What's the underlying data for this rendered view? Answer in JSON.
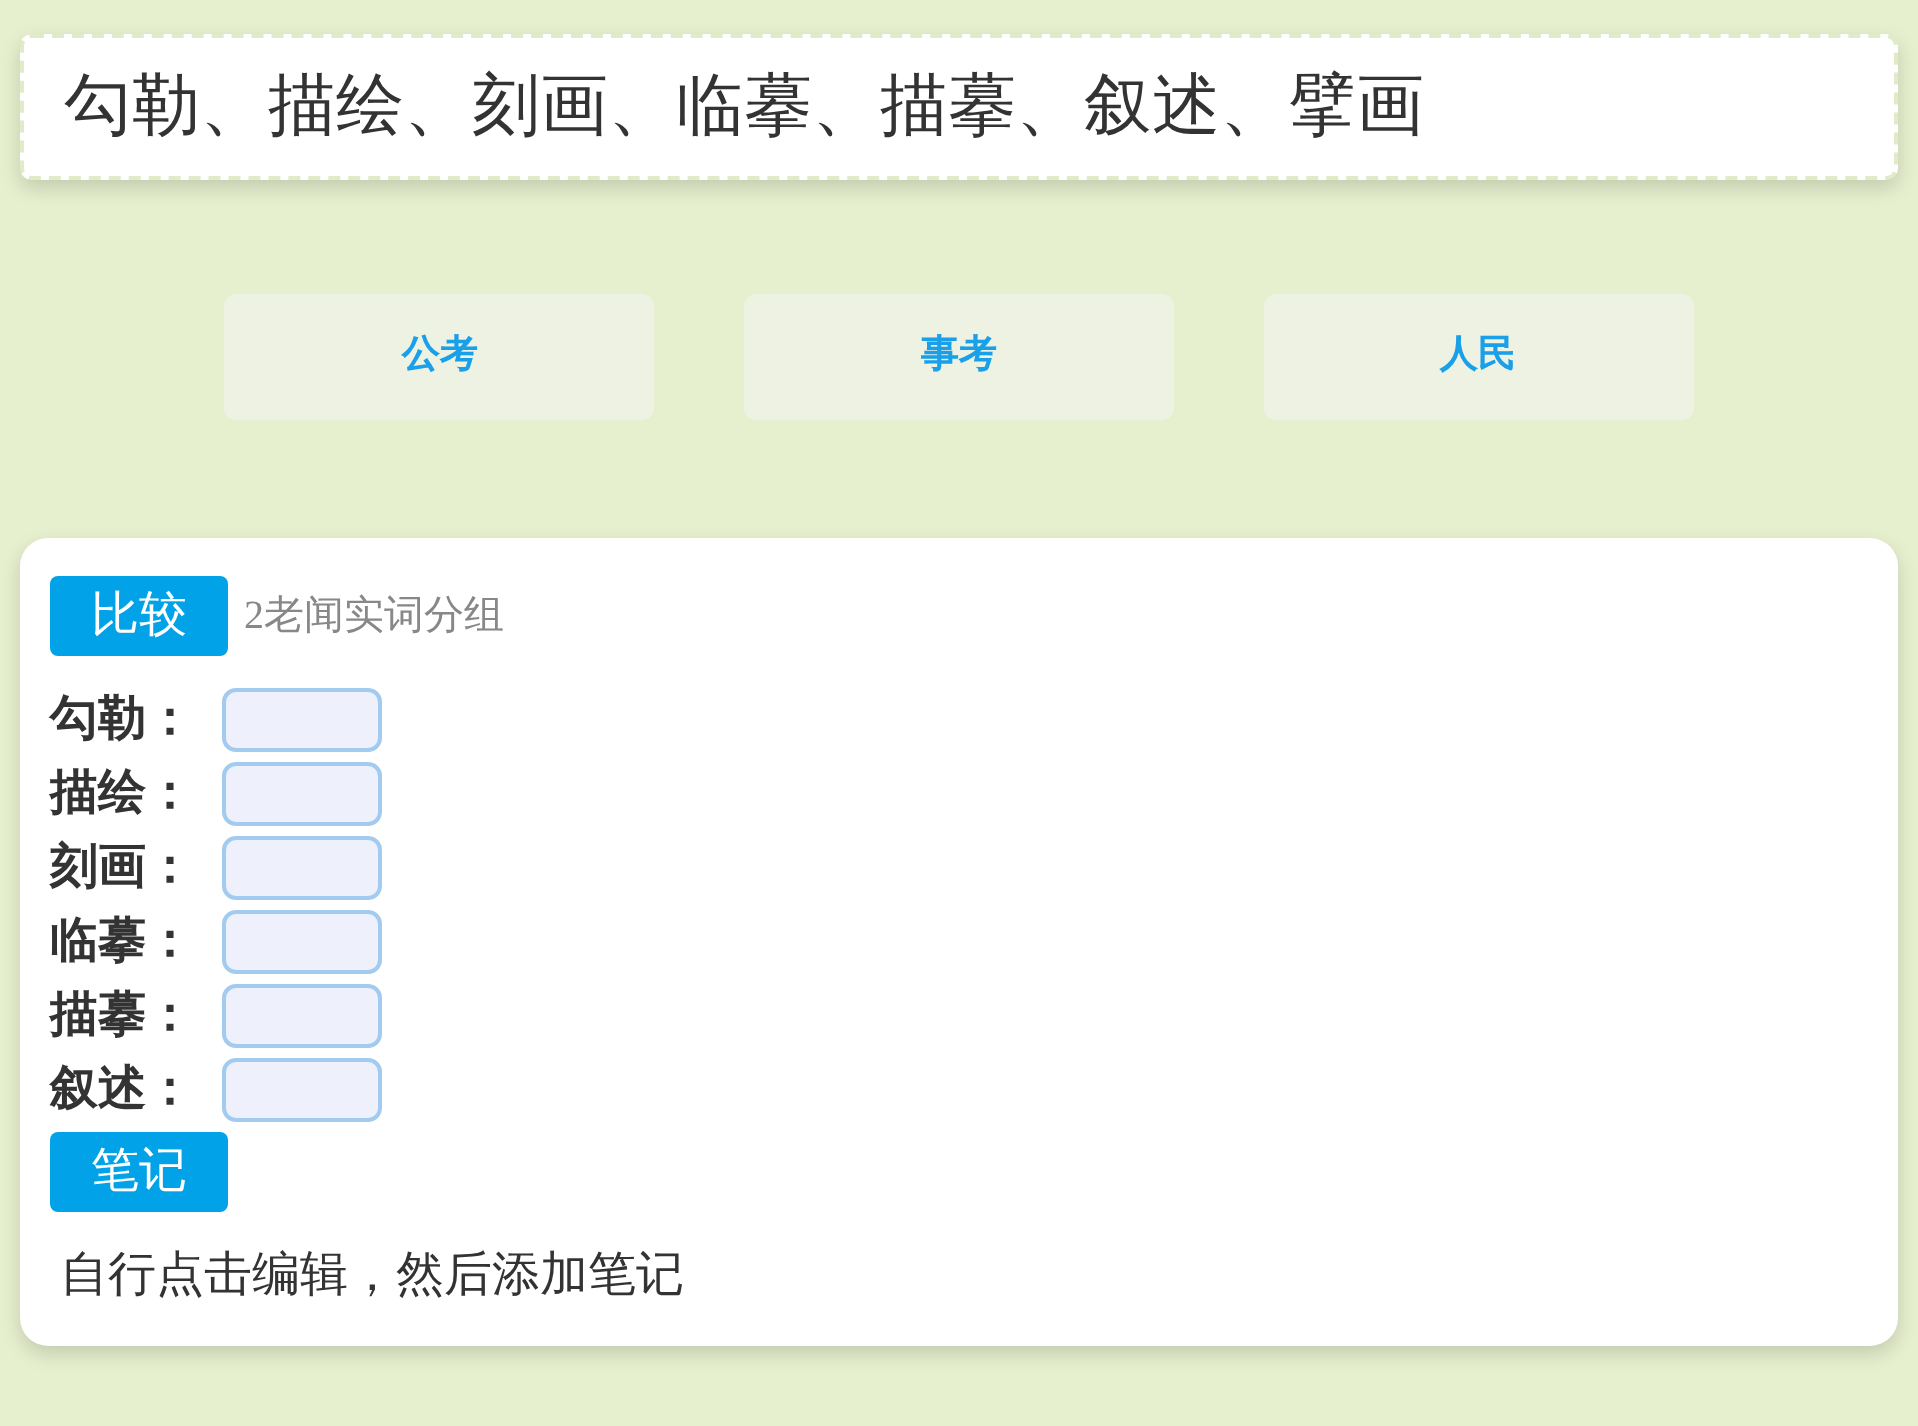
{
  "header": {
    "text": "勾勒、描绘、刻画、临摹、描摹、叙述、擘画"
  },
  "sources": [
    {
      "label": "公考"
    },
    {
      "label": "事考"
    },
    {
      "label": "人民"
    }
  ],
  "card": {
    "badge": "比较",
    "subtitle": "2老闻实词分组",
    "fields": [
      {
        "label": "勾勒："
      },
      {
        "label": "描绘："
      },
      {
        "label": "刻画："
      },
      {
        "label": "临摹："
      },
      {
        "label": "描摹："
      },
      {
        "label": "叙述："
      }
    ],
    "notes_badge": "笔记",
    "notes_text": "自行点击编辑，然后添加笔记"
  }
}
